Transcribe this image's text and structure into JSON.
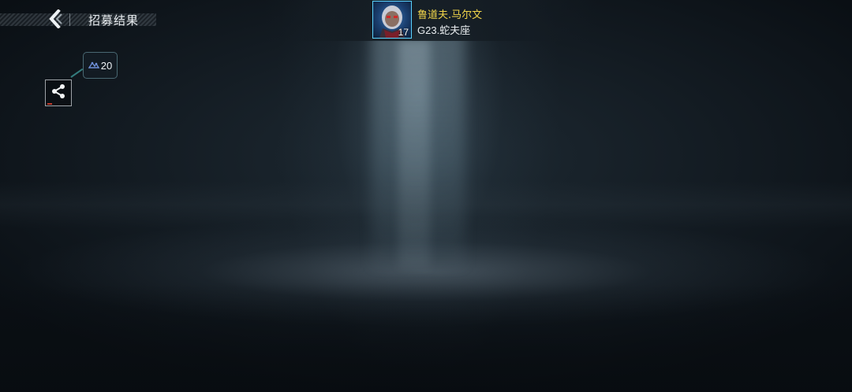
{
  "header": {
    "title": "招募结果",
    "back_icon": "chevron-left-icon"
  },
  "hero": {
    "name": "鲁道夫.马尔文",
    "subtitle": "G23.蛇夫座",
    "level": "17",
    "name_color": "#f2d64a",
    "frame_color": "#5ad2ff"
  },
  "currency": {
    "icon": "cosmic-resource-icon",
    "value": "20"
  },
  "share": {
    "icon": "share-icon"
  }
}
